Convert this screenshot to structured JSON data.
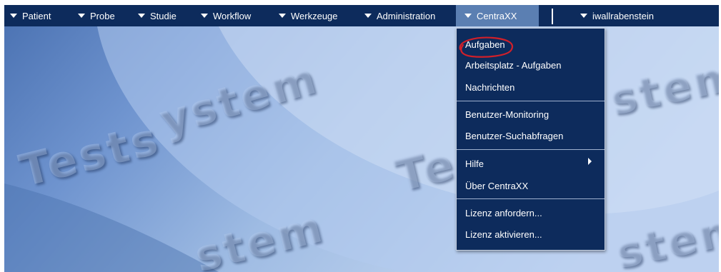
{
  "nav": {
    "items": [
      {
        "label": "Patient"
      },
      {
        "label": "Probe"
      },
      {
        "label": "Studie"
      },
      {
        "label": "Workflow"
      },
      {
        "label": "Werkzeuge"
      },
      {
        "label": "Administration"
      },
      {
        "label": "CentraXX"
      }
    ],
    "user": "iwallrabenstein"
  },
  "menu": {
    "items": [
      {
        "label": "Aufgaben"
      },
      {
        "label": "Arbeitsplatz - Aufgaben"
      },
      {
        "label": "Nachrichten"
      },
      {
        "label": "Benutzer-Monitoring"
      },
      {
        "label": "Benutzer-Suchabfragen"
      },
      {
        "label": "Hilfe"
      },
      {
        "label": "Über CentraXX"
      },
      {
        "label": "Lizenz anfordern..."
      },
      {
        "label": "Lizenz aktivieren..."
      }
    ]
  },
  "watermark": {
    "text1": "Tests",
    "text2": "ystem",
    "text3": "Tes",
    "text4": "stem",
    "text5": "stem",
    "text6": "stem"
  },
  "colors": {
    "nav_background": "#0d2b5c",
    "active_item": "#5b7fb2",
    "annotation": "#d0202a"
  }
}
